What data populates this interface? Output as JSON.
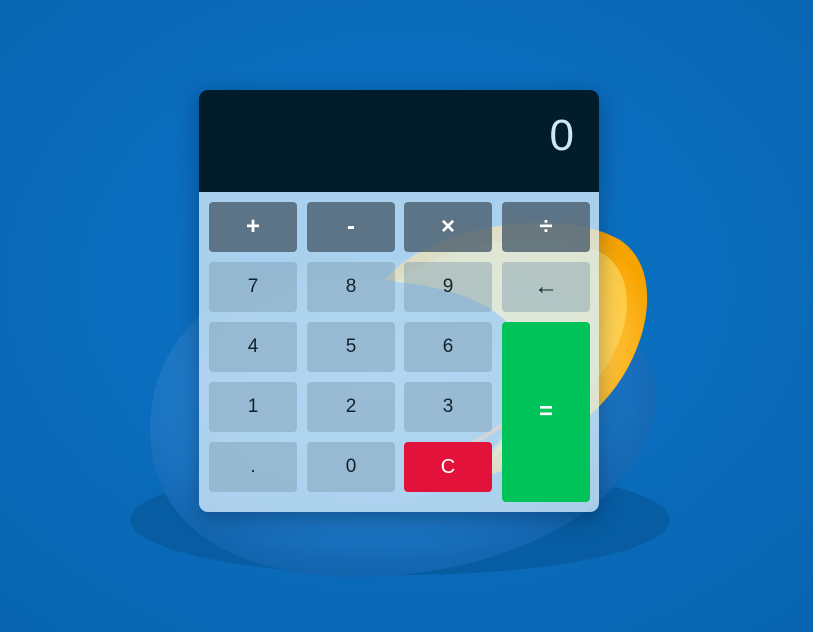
{
  "display": {
    "value": "0"
  },
  "keys": {
    "add": "+",
    "subtract": "-",
    "multiply": "×",
    "divide": "÷",
    "seven": "7",
    "eight": "8",
    "nine": "9",
    "backspace": "←",
    "four": "4",
    "five": "5",
    "six": "6",
    "one": "1",
    "two": "2",
    "three": "3",
    "equals": "=",
    "decimal": ".",
    "zero": "0",
    "clear": "C"
  },
  "colors": {
    "page_background": "#0a6ec0",
    "display_background": "#011c2a",
    "clear_key": "#e2123a",
    "equals_key": "#00c45a"
  }
}
